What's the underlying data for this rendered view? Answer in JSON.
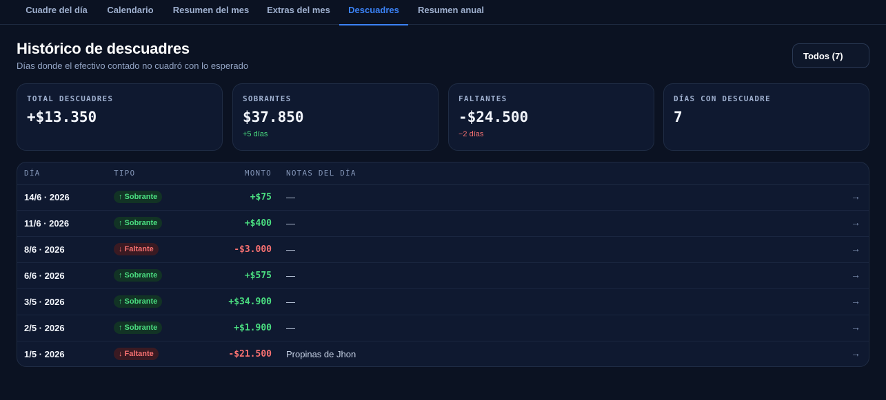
{
  "tabs": [
    {
      "label": "Cuadre del día"
    },
    {
      "label": "Calendario"
    },
    {
      "label": "Resumen del mes"
    },
    {
      "label": "Extras del mes"
    },
    {
      "label": "Descuadres",
      "active": true
    },
    {
      "label": "Resumen anual"
    }
  ],
  "header": {
    "title": "Histórico de descuadres",
    "subtitle": "Días donde el efectivo contado no cuadró con lo esperado",
    "filter_label": "Todos (7)"
  },
  "cards": [
    {
      "label": "TOTAL DESCUADRES",
      "value": "+$13.350",
      "sub": ""
    },
    {
      "label": "SOBRANTES",
      "value": "$37.850",
      "sub": "+5 días"
    },
    {
      "label": "FALTANTES",
      "value": "-$24.500",
      "sub": "−2 días"
    },
    {
      "label": "DÍAS CON DESCUADRE",
      "value": "7",
      "sub": ""
    }
  ],
  "table": {
    "headers": {
      "day": "DÍA",
      "type": "TIPO",
      "amount": "MONTO",
      "notes": "NOTAS DEL DÍA"
    },
    "arrow_icon": "→",
    "rows": [
      {
        "day": "14/6 · 2026",
        "type": "↑ Sobrante",
        "kind": "up",
        "amount": "+$75",
        "note": "—"
      },
      {
        "day": "11/6 · 2026",
        "type": "↑ Sobrante",
        "kind": "up",
        "amount": "+$400",
        "note": "—"
      },
      {
        "day": "8/6 · 2026",
        "type": "↓ Faltante",
        "kind": "down",
        "amount": "-$3.000",
        "note": "—"
      },
      {
        "day": "6/6 · 2026",
        "type": "↑ Sobrante",
        "kind": "up",
        "amount": "+$575",
        "note": "—"
      },
      {
        "day": "3/5 · 2026",
        "type": "↑ Sobrante",
        "kind": "up",
        "amount": "+$34.900",
        "note": "—"
      },
      {
        "day": "2/5 · 2026",
        "type": "↑ Sobrante",
        "kind": "up",
        "amount": "+$1.900",
        "note": "—"
      },
      {
        "day": "1/5 · 2026",
        "type": "↓ Faltante",
        "kind": "down",
        "amount": "-$21.500",
        "note": "Propinas de Jhon"
      }
    ]
  },
  "colors": {
    "accent": "#3b82f6",
    "positive": "#4ade80",
    "negative": "#f87171"
  }
}
